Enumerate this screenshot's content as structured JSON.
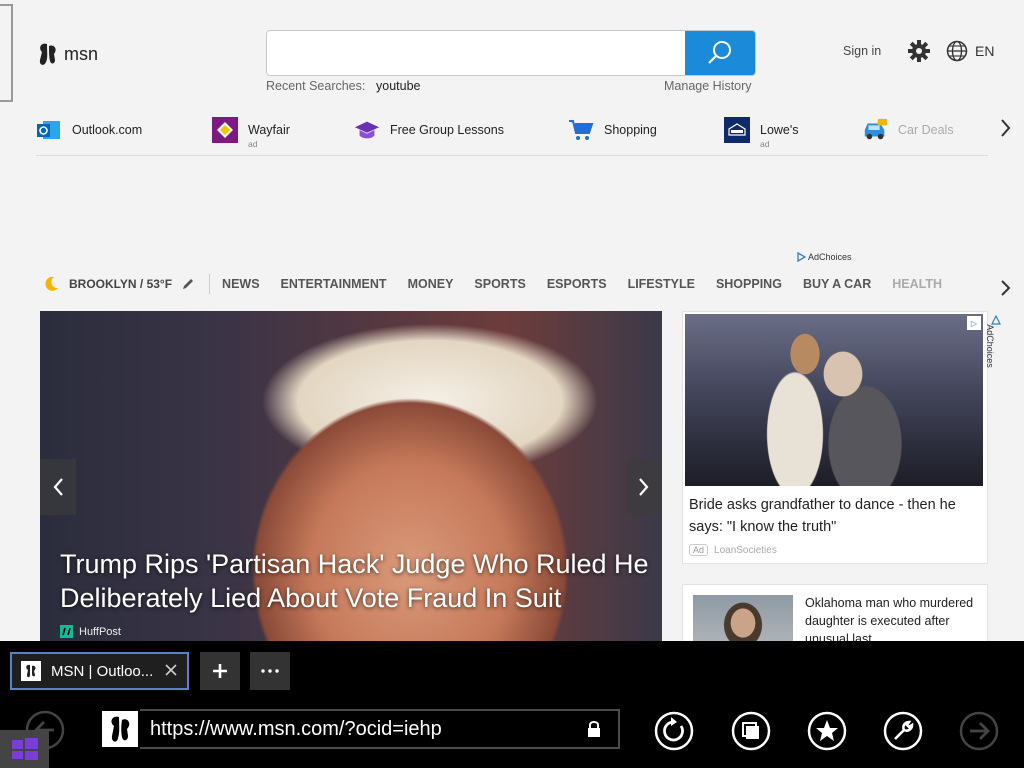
{
  "header": {
    "logo_text": "msn",
    "search_placeholder": "",
    "recent_label": "Recent Searches:",
    "recent_item": "youtube",
    "manage_history": "Manage History",
    "sign_in": "Sign in",
    "language": "EN"
  },
  "quicklinks": [
    {
      "label": "Outlook.com",
      "ad": ""
    },
    {
      "label": "Wayfair",
      "ad": "ad"
    },
    {
      "label": "Free Group Lessons",
      "ad": ""
    },
    {
      "label": "Shopping",
      "ad": ""
    },
    {
      "label": "Lowe's",
      "ad": "ad"
    },
    {
      "label": "Car Deals",
      "ad": ""
    }
  ],
  "adchoices_label": "AdChoices",
  "weather": {
    "location": "BROOKLYN / 53°F"
  },
  "categories": [
    "NEWS",
    "ENTERTAINMENT",
    "MONEY",
    "SPORTS",
    "ESPORTS",
    "LIFESTYLE",
    "SHOPPING",
    "BUY A CAR",
    "HEALTH"
  ],
  "hero": {
    "title": "Trump Rips 'Partisan Hack' Judge Who Ruled He Deliberately Lied About Vote Fraud In Suit",
    "source": "HuffPost"
  },
  "ad_card": {
    "title": "Bride asks grandfather to dance - then he says: \"I know the truth\"",
    "ad_label": "Ad",
    "sponsor": "LoanSocieties"
  },
  "news_card": {
    "title": "Oklahoma man who murdered daughter is executed after unusual last..."
  },
  "browser": {
    "tab_title": "MSN | Outloo...",
    "url": "https://www.msn.com/?ocid=iehp",
    "new_tab": "+",
    "more_tabs": "···"
  },
  "colors": {
    "accent": "#1a8ad9",
    "tab_border": "#5a7fd0",
    "start": "#7a3ed6"
  }
}
